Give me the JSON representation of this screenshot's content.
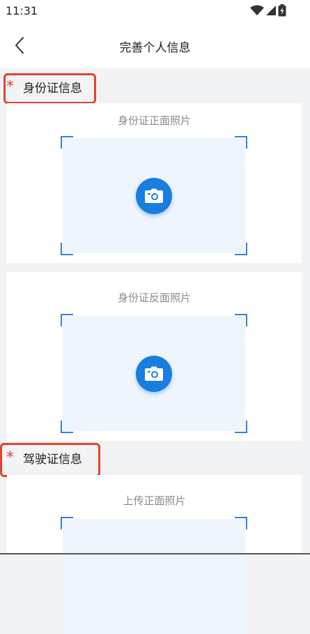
{
  "status": {
    "time": "11:31"
  },
  "header": {
    "title": "完善个人信息"
  },
  "sections": [
    {
      "required_mark": "*",
      "title": "身份证信息"
    },
    {
      "required_mark": "*",
      "title": "驾驶证信息"
    }
  ],
  "uploads": {
    "id_front": {
      "label": "身份证正面照片",
      "icon": "camera-icon"
    },
    "id_back": {
      "label": "身份证反面照片",
      "icon": "camera-icon"
    },
    "license_front": {
      "label": "上传正面照片",
      "icon": "camera-icon"
    }
  },
  "colors": {
    "accent": "#1a7de0",
    "required": "#e2442f",
    "upload_bg": "#eef5fd",
    "page_bg": "#f2f3f5"
  }
}
